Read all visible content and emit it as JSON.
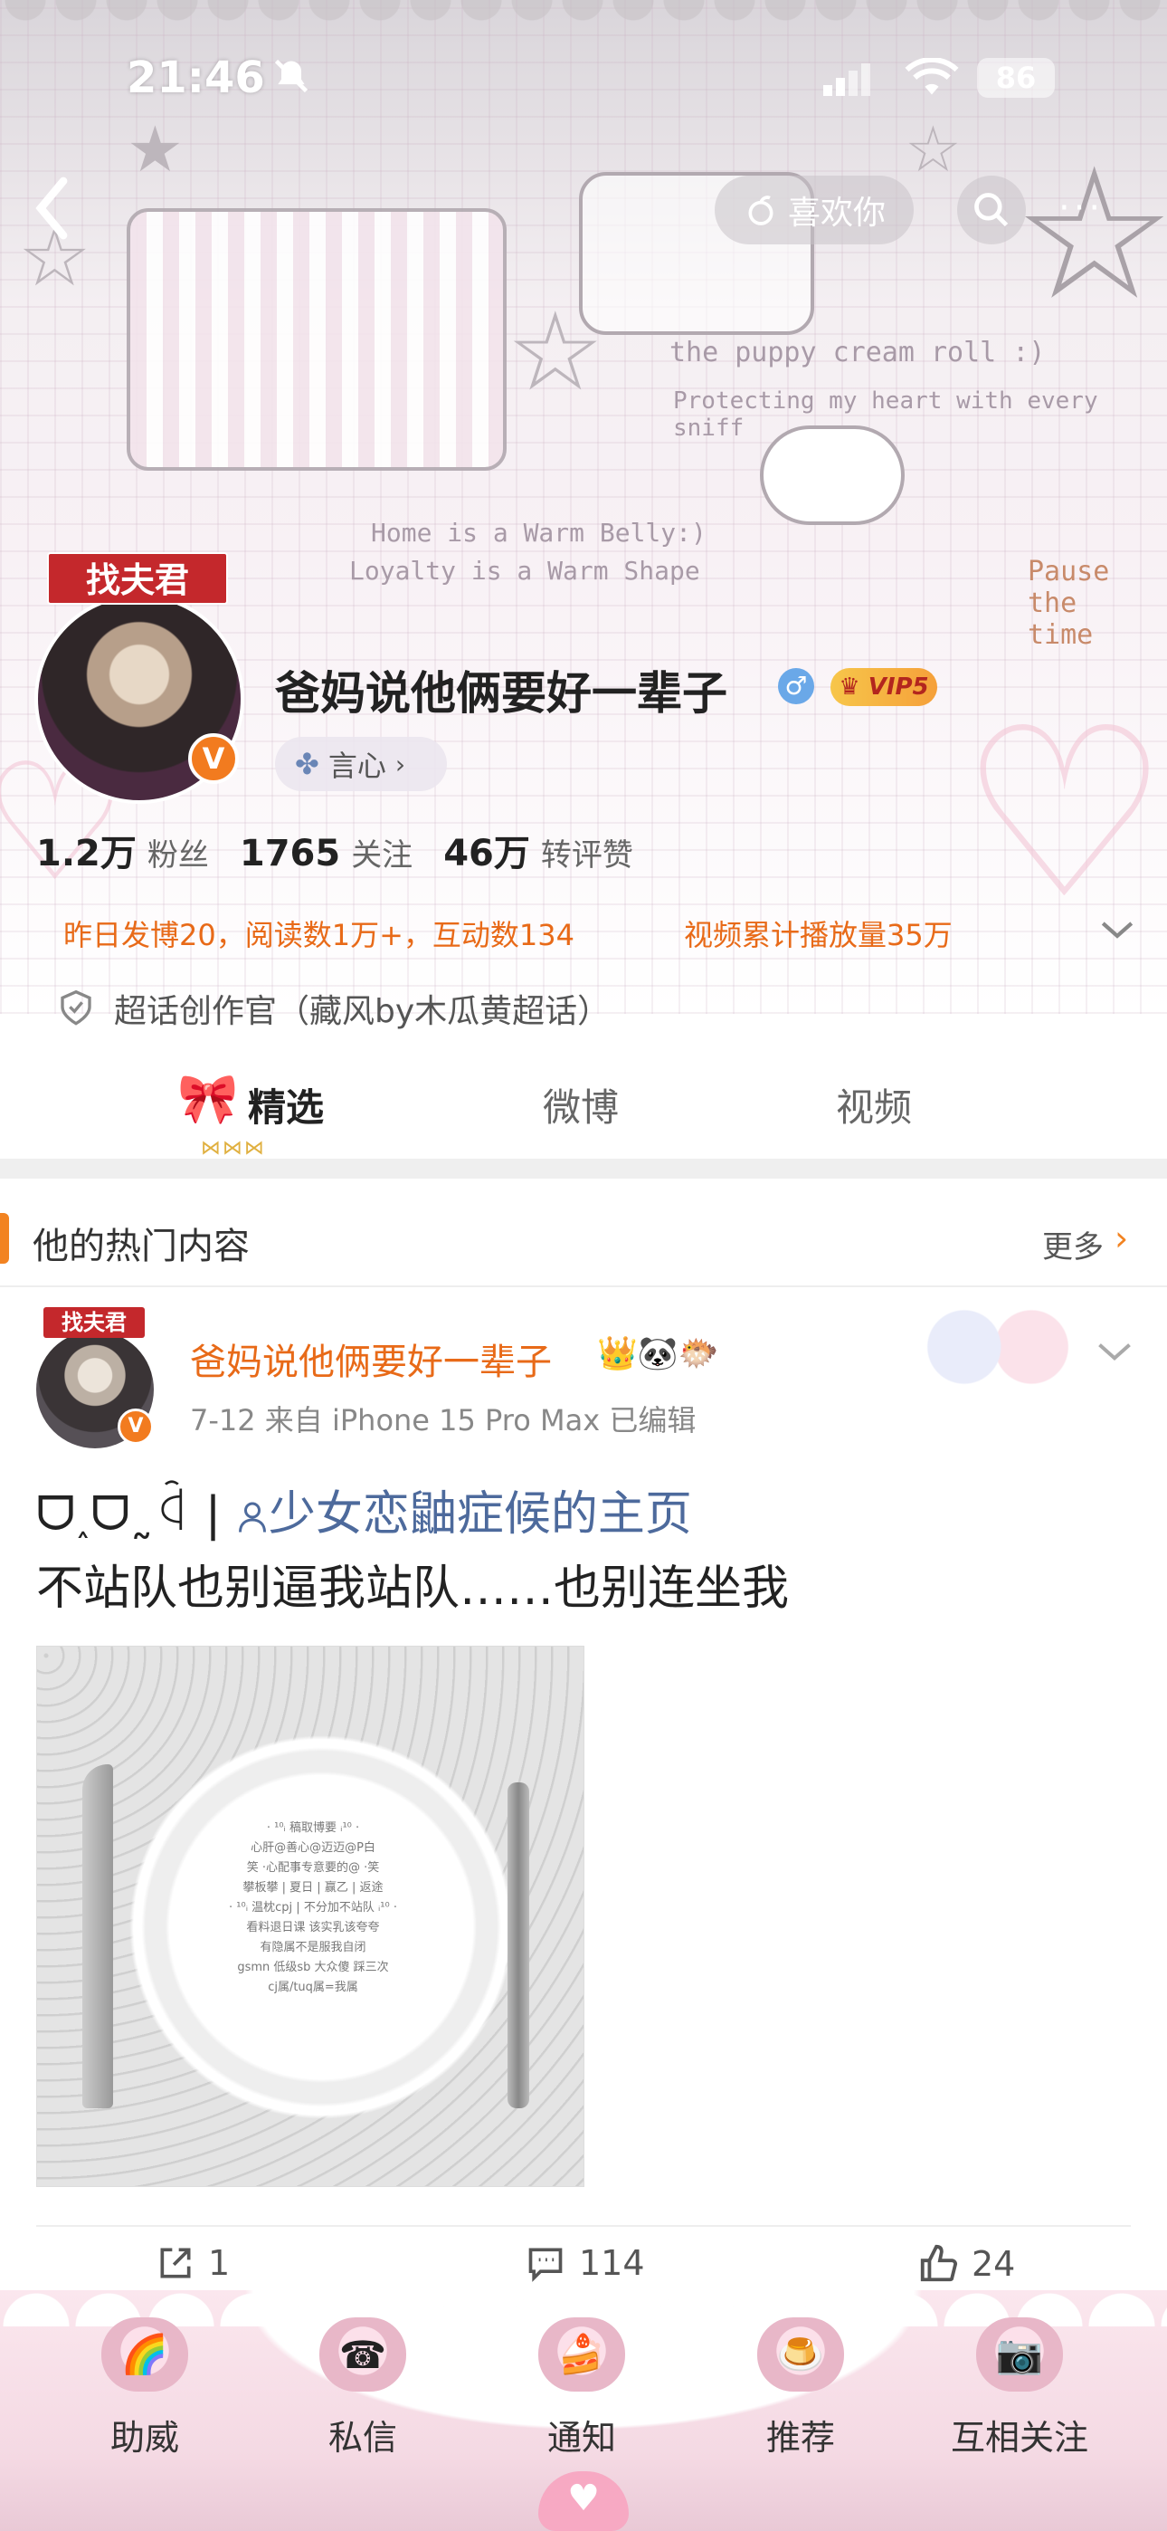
{
  "status_bar": {
    "time": "21:46",
    "battery": "86"
  },
  "nav": {
    "like_label": "喜欢你"
  },
  "banner_text": {
    "line1": "the puppy cream roll :)",
    "line2": "Protecting my heart with every sniff",
    "line3": "Home is a Warm Belly:)",
    "line4": "Loyalty is a Warm Shape",
    "line5": "Pause the time"
  },
  "profile": {
    "avatar_tag": "找夫君",
    "username": "爸妈说他俩要好一辈子",
    "vip_label": "VIP5",
    "source_label": "言心",
    "stats": [
      {
        "num": "1.2万",
        "label": "粉丝"
      },
      {
        "num": "1765",
        "label": "关注"
      },
      {
        "num": "46万",
        "label": "转评赞"
      }
    ],
    "activity_left": "昨日发博20，阅读数1万+，互动数134",
    "activity_right": "视频累计播放量35万",
    "super_topic": "超话创作官（藏风by木瓜黄超话）"
  },
  "tabs": [
    {
      "label": "精选"
    },
    {
      "label": "微博"
    },
    {
      "label": "视频"
    }
  ],
  "hot": {
    "title": "他的热门内容",
    "more": "更多"
  },
  "post": {
    "avatar_tag": "找夫君",
    "author": "爸妈说他俩要好一辈子",
    "author_emoji": "👑🐼🐡",
    "meta": "7-12  来自 iPhone 15 Pro Max  已编辑",
    "line1_prefix": "ᗜ˰ᗜ˷ꒈ  |",
    "line1_link": "少女恋鼬症候的主页",
    "line2": "不站队也别逼我站队……也别连坐我",
    "image_lines": [
      "· ¹⁰ᵢ 稿取博要 ᵢ¹⁰ ·",
      "心肝@善心@迈迈@P白",
      "笑 ·心配事专意要的@ ·笑",
      "攀板攀 | 夏日 | 赢乙 | 返途",
      "· ¹⁰ᵢ 温枕cpj | 不分加不站队 ᵢ¹⁰ ·",
      "看料退日课 该实乳该夸夸",
      "有隐属不是服我自闭",
      "gsmn 低级sb 大众傻 踩三次",
      "cj属/tuq属=我属"
    ],
    "repost_count": "1",
    "comment_count": "114",
    "like_count": "24"
  },
  "bottom_nav": [
    {
      "label": "助威",
      "icon": "rainbow-icon"
    },
    {
      "label": "私信",
      "icon": "telephone-icon"
    },
    {
      "label": "通知",
      "icon": "cake-icon"
    },
    {
      "label": "推荐",
      "icon": "pudding-icon"
    },
    {
      "label": "互相关注",
      "icon": "camera-icon"
    }
  ]
}
